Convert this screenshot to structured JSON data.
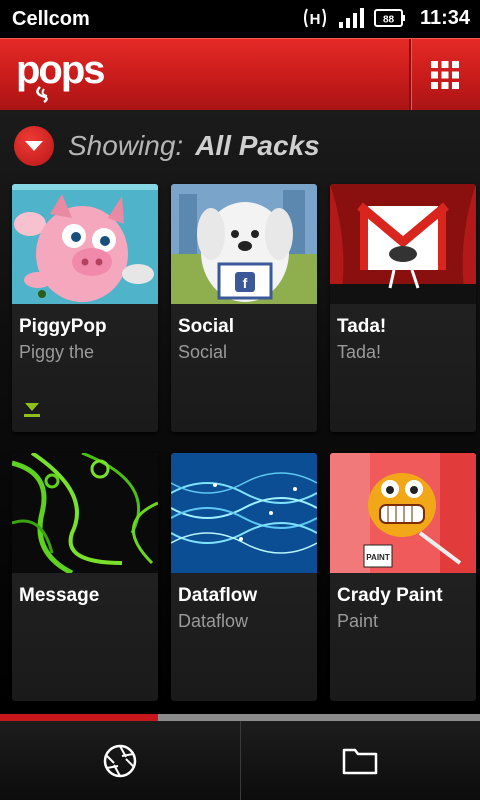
{
  "status_bar": {
    "carrier": "Cellcom",
    "network_type": "H",
    "battery_level": "88",
    "time": "11:34"
  },
  "app_bar": {
    "logo_text": "pops",
    "menu_icon": "grid-icon"
  },
  "filter": {
    "label": "Showing:",
    "value": "All Packs"
  },
  "packs": [
    {
      "title": "PiggyPop",
      "subtitle": "Piggy the",
      "downloadable": true
    },
    {
      "title": "Social",
      "subtitle": "Social",
      "downloadable": false
    },
    {
      "title": "Tada!",
      "subtitle": "Tada!",
      "downloadable": false
    },
    {
      "title": "Message",
      "subtitle": "",
      "downloadable": false
    },
    {
      "title": "Dataflow",
      "subtitle": "Dataflow",
      "downloadable": false
    },
    {
      "title": "Crady Paint",
      "subtitle": "Paint",
      "downloadable": false
    }
  ],
  "page_progress": 0.33,
  "bottom_bar": {
    "left_icon": "camera-shutter-icon",
    "right_icon": "folder-icon"
  },
  "colors": {
    "accent": "#c8171b",
    "download": "#8fbf1a"
  }
}
